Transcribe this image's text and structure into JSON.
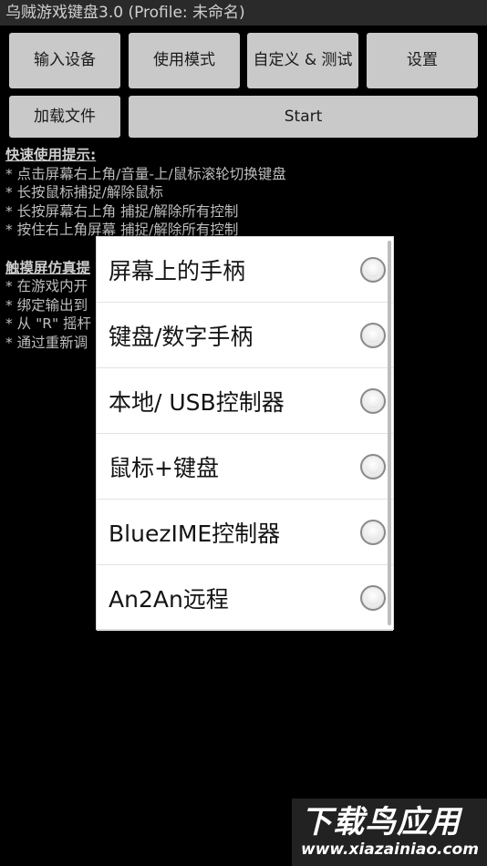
{
  "titlebar": {
    "title": "乌贼游戏键盘3.0 (Profile: 未命名)"
  },
  "buttons": {
    "input_device": "输入设备",
    "usage_mode": "使用模式",
    "customize_test": "自定义 & 测试",
    "settings": "设置",
    "load_file": "加载文件",
    "start": "Start"
  },
  "tips": {
    "quick_heading": "快速使用提示:",
    "quick_lines": [
      "* 点击屏幕右上角/音量-上/鼠标滚轮切换键盘",
      "* 长按鼠标捕捉/解除鼠标",
      "* 长按屏幕右上角 捕捉/解除所有控制",
      "* 按住右上角屏幕 捕捉/解除所有控制"
    ],
    "touch_heading": "触摸屏仿真提",
    "touch_lines": [
      "* 在游戏内开",
      "* 绑定输出到",
      "* 从 \"R\" 摇杆",
      "* 通过重新调"
    ]
  },
  "dialog": {
    "options": [
      {
        "label": "屏幕上的手柄",
        "selected": false
      },
      {
        "label": "键盘/数字手柄",
        "selected": false
      },
      {
        "label": "本地/ USB控制器",
        "selected": false
      },
      {
        "label": "鼠标+键盘",
        "selected": false
      },
      {
        "label": "BluezIME控制器",
        "selected": false
      },
      {
        "label": "An2An远程",
        "selected": false
      }
    ]
  },
  "watermark": {
    "brand": "下载鸟应用",
    "url": "www.xiazainiao.com"
  },
  "colors": {
    "background": "#000000",
    "button": "#c9c9c9",
    "dialog": "#ffffff"
  },
  "icons": {
    "radio": "radio-button-unchecked-icon"
  }
}
